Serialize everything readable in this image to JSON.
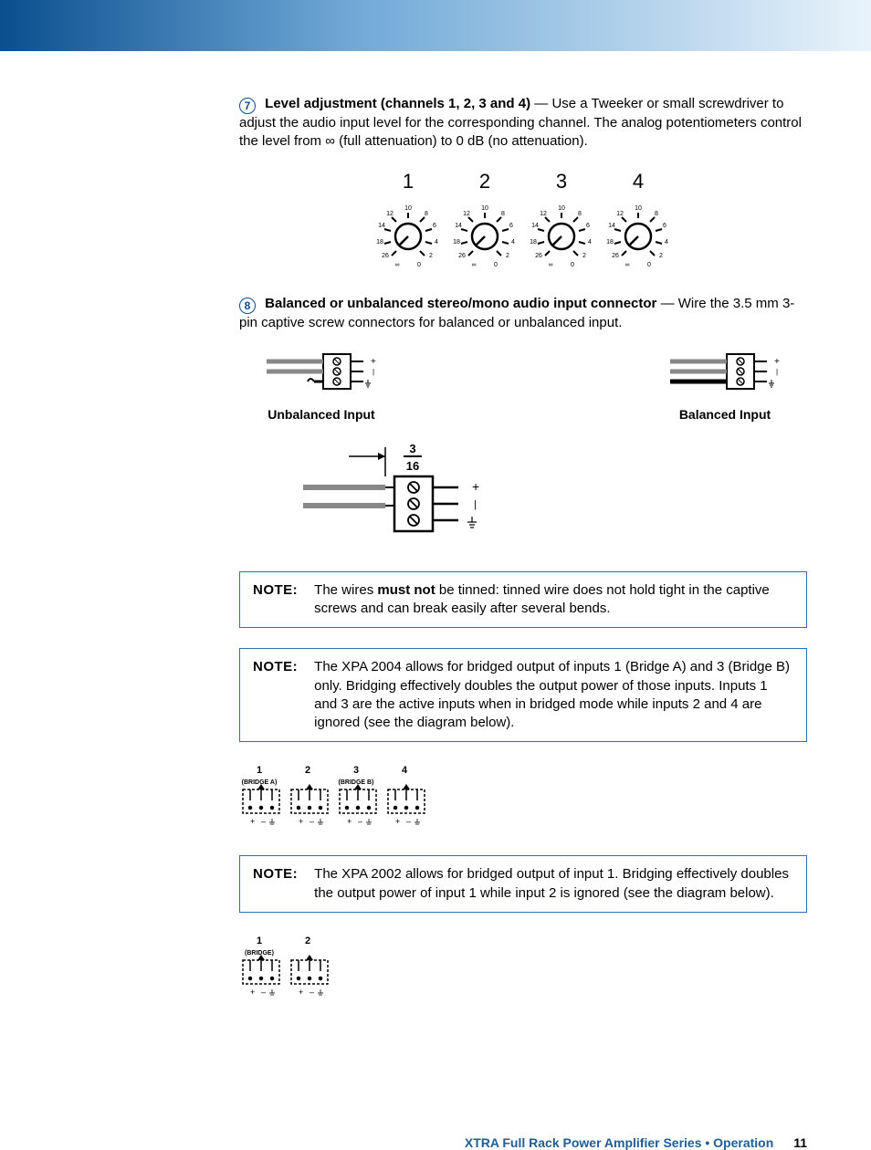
{
  "item7": {
    "num": "7",
    "title": "Level adjustment (channels 1, 2, 3 and 4)",
    "sep": " — ",
    "desc_lead": "Use a Tweeker or small screwdriver to adjust the audio input level for the corresponding channel. The analog potentiometers control the level from ",
    "inf": "∞",
    "desc_tail": " (full attenuation) to 0 dB (no attenuation)."
  },
  "dials": {
    "labels": [
      "1",
      "2",
      "3",
      "4"
    ],
    "ticks_left": [
      "26",
      "18",
      "14",
      "12",
      "10"
    ],
    "ticks_right": [
      "8",
      "6",
      "4",
      "2",
      "0"
    ],
    "left_end": "∞"
  },
  "item8": {
    "num": "8",
    "title": "Balanced or unbalanced stereo/mono audio input connector",
    "sep": " — ",
    "desc": "Wire the 3.5 mm 3-pin captive screw connectors for balanced or unbalanced input."
  },
  "conn": {
    "unbalanced": "Unbalanced Input",
    "balanced": "Balanced Input",
    "frac_top": "3",
    "frac_bot": "16"
  },
  "note1": {
    "label": "NOTE:",
    "pre": "The wires ",
    "bold": "must not",
    "post": " be tinned: tinned wire does not hold tight in the captive screws and can break easily after several bends."
  },
  "note2": {
    "label": "NOTE:",
    "text": "The XPA 2004 allows for bridged output of inputs 1 (Bridge A) and 3 (Bridge B) only. Bridging effectively doubles the output power of those inputs. Inputs 1 and 3 are the active inputs when in bridged mode while inputs 2 and 4 are ignored (see the diagram below)."
  },
  "bridge4": {
    "labels": [
      "1",
      "2",
      "3",
      "4"
    ],
    "sub_a": "(BRIDGE A)",
    "sub_b": "(BRIDGE B)",
    "pins": [
      "+",
      "–",
      "⏚"
    ]
  },
  "note3": {
    "label": "NOTE:",
    "text": "The XPA 2002 allows for bridged output of input 1. Bridging effectively doubles the output power of input 1 while input 2 is ignored (see the diagram below)."
  },
  "bridge2": {
    "labels": [
      "1",
      "2"
    ],
    "sub": "(BRIDGE)",
    "pins": [
      "+",
      "–",
      "⏚"
    ]
  },
  "footer": {
    "line": "XTRA Full Rack Power Amplifier Series  •  Operation",
    "page": "11"
  }
}
